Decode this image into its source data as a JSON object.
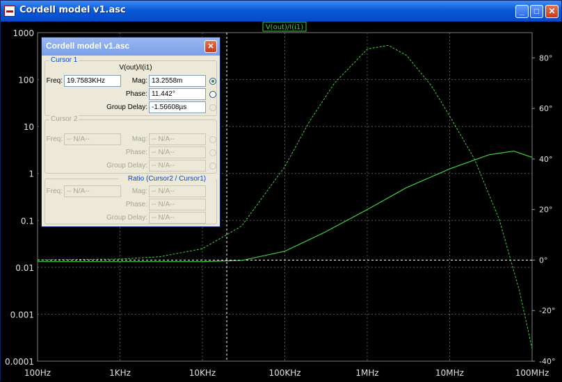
{
  "window": {
    "title": "Cordell model v1.asc",
    "minimize_glyph": "_",
    "maximize_glyph": "□",
    "close_glyph": "✕"
  },
  "trace_label": "V(out)/I(i1)",
  "chart_data": {
    "type": "line",
    "title": "",
    "x_scale": "log",
    "x_range_hz": [
      100,
      100000000
    ],
    "x_ticks": [
      "100Hz",
      "1KHz",
      "10KHz",
      "100KHz",
      "1MHz",
      "10MHz",
      "100MHz"
    ],
    "y_left_scale": "log",
    "y_left_range": [
      0.0001,
      1000
    ],
    "y_left_ticks": [
      "1000",
      "100",
      "10",
      "1",
      "0.1",
      "0.01",
      "0.001",
      "0.0001"
    ],
    "y_right_range_deg": [
      -40,
      90
    ],
    "y_right_ticks": [
      "80°",
      "60°",
      "40°",
      "20°",
      "0°",
      "-20°",
      "-40°"
    ],
    "grid": true,
    "cursor_x_hz": 19758.3,
    "series": [
      {
        "name": "magnitude",
        "axis": "left",
        "style": "solid",
        "color": "#40d040",
        "x": [
          100,
          1000,
          10000,
          30000,
          100000,
          300000,
          1000000,
          3000000,
          10000000,
          30000000,
          60000000,
          100000000
        ],
        "y": [
          0.0132,
          0.0132,
          0.0132,
          0.014,
          0.022,
          0.055,
          0.17,
          0.5,
          1.25,
          2.5,
          3.0,
          2.2
        ]
      },
      {
        "name": "phase",
        "axis": "right",
        "style": "dashed",
        "color": "#40d040",
        "x": [
          100,
          1000,
          3000,
          10000,
          30000,
          100000,
          200000,
          400000,
          1000000,
          1800000,
          3000000,
          6000000,
          10000000,
          20000000,
          40000000,
          70000000,
          100000000
        ],
        "y": [
          0.1,
          0.4,
          1.3,
          4.5,
          13.5,
          37,
          55,
          70,
          83.5,
          85,
          81,
          69,
          57,
          40,
          16,
          -12,
          -35
        ]
      }
    ]
  },
  "dialog": {
    "title": "Cordell model v1.asc",
    "close_glyph": "✕",
    "cursor1": {
      "group_label": "Cursor 1",
      "trace": "V(out)/I(i1)",
      "freq_label": "Freq:",
      "freq_value": "19.7583KHz",
      "mag_label": "Mag:",
      "mag_value": "13.2558m",
      "phase_label": "Phase:",
      "phase_value": "11.442°",
      "group_delay_label": "Group Delay:",
      "group_delay_value": "-1.56608µs"
    },
    "cursor2": {
      "group_label": "Cursor 2",
      "freq_label": "Freq:",
      "freq_value": "-- N/A--",
      "mag_label": "Mag:",
      "mag_value": "-- N/A--",
      "phase_label": "Phase:",
      "phase_value": "-- N/A--",
      "group_delay_label": "Group Delay:",
      "group_delay_value": "-- N/A--"
    },
    "ratio": {
      "group_label": "Ratio (Cursor2 / Cursor1)",
      "freq_label": "Freq:",
      "freq_value": "-- N/A--",
      "mag_label": "Mag:",
      "mag_value": "-- N/A--",
      "phase_label": "Phase:",
      "phase_value": "-- N/A--",
      "group_delay_label": "Group Delay:",
      "group_delay_value": "-- N/A--"
    }
  }
}
